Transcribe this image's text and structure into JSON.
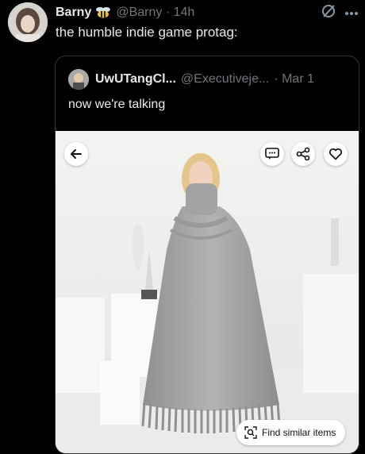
{
  "tweet": {
    "author_name": "Barny",
    "handle": "@Barny · 14h",
    "text": "the humble indie game protag:"
  },
  "quoted_tweet": {
    "author_name": "UwUTangCl...",
    "handle": "@Executiveje...",
    "date": "· Mar 1",
    "text": "now we're talking"
  },
  "photo_overlay": {
    "find_similar_label": "Find similar items"
  },
  "icons": {
    "verified": "bee-badge-icon",
    "header": [
      "grok-icon",
      "more-icon"
    ],
    "photo": [
      "back-arrow-icon",
      "comment-icon",
      "share-icon",
      "heart-icon",
      "lens-icon"
    ]
  }
}
